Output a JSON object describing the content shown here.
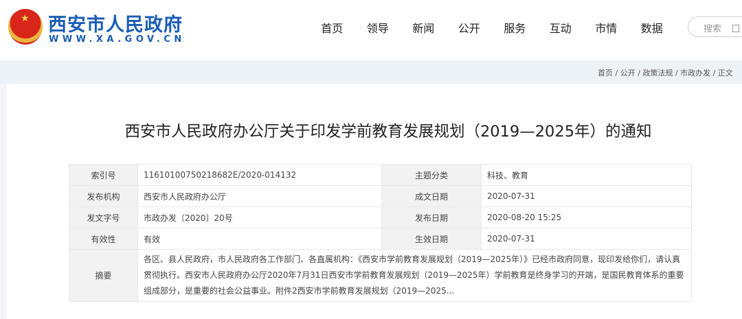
{
  "header": {
    "site_name": "西安市人民政府",
    "site_url": "WWW.XA.GOV.CN",
    "nav": [
      "首页",
      "领导",
      "新闻",
      "公开",
      "服务",
      "互动",
      "市情",
      "数据"
    ],
    "search_placeholder": "搜索"
  },
  "breadcrumb": "首页 /  公开 / 政策法规 / 市政办发 / 正文",
  "article": {
    "title": "西安市人民政府办公厅关于印发学前教育发展规划（2019—2025年）的通知",
    "meta": [
      {
        "label1": "索引号",
        "value1": "11610100750218682E/2020-014132",
        "label2": "主题分类",
        "value2": "科技、教育"
      },
      {
        "label1": "发布机构",
        "value1": "西安市人民政府办公厅",
        "label2": "成文日期",
        "value2": "2020-07-31"
      },
      {
        "label1": "发文字号",
        "value1": "市政办发〔2020〕20号",
        "label2": "发布日期",
        "value2": "2020-08-20 15:25"
      },
      {
        "label1": "有效性",
        "value1": "有效",
        "label2": "生效日期",
        "value2": "2020-07-31"
      }
    ],
    "summary_label": "摘要",
    "summary": "各区、县人民政府，市人民政府各工作部门、各直属机构：《西安市学前教育发展规划（2019—2025年）》已经市政府同意，现印发给你们，请认真贯彻执行。西安市人民政府办公厅2020年7月31日西安市学前教育发展规划（2019—2025年）学前教育是终身学习的开端，是国民教育体系的重要组成部分，是重要的社会公益事业。附件2西安市学前教育发展规划（2019—2025..."
  }
}
